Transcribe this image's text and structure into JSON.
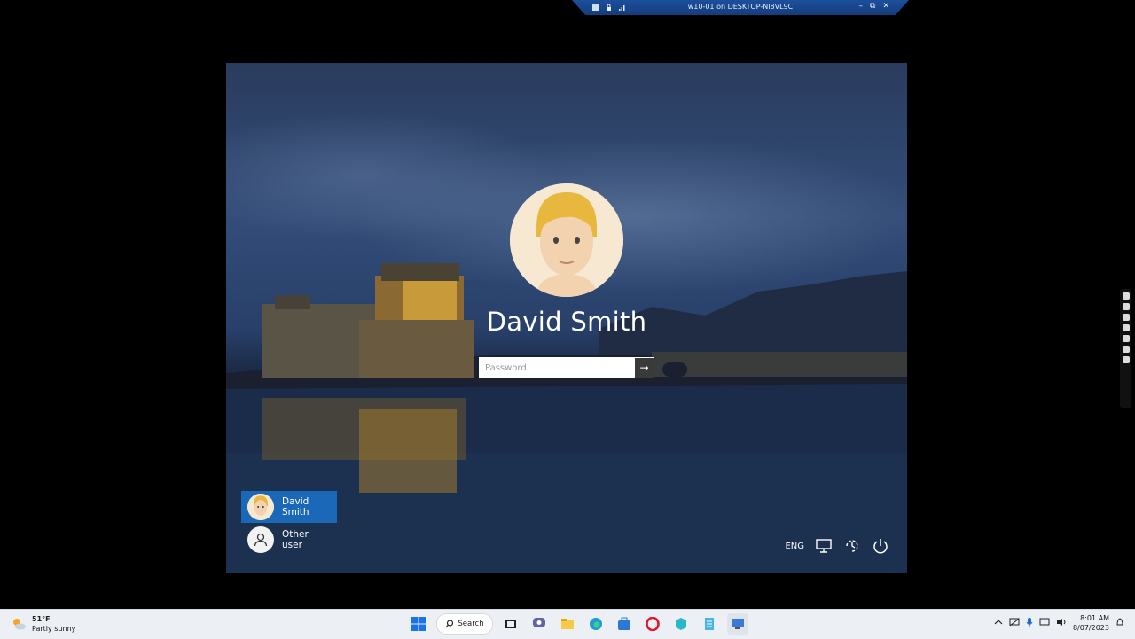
{
  "connection_bar": {
    "title": "w10-01 on DESKTOP-NI8VL9C",
    "minimize_label": "–",
    "restore_label": "⧉",
    "close_label": "✕"
  },
  "lockscreen": {
    "user_name": "David Smith",
    "password_placeholder": "Password",
    "submit_label": "→",
    "tiles": [
      {
        "label": "David Smith",
        "selected": true
      },
      {
        "label": "Other user",
        "selected": false
      }
    ],
    "language": "ENG",
    "icons": [
      "network-icon",
      "accessibility-icon",
      "power-icon"
    ]
  },
  "taskbar": {
    "weather_temp": "51°F",
    "weather_text": "Partly sunny",
    "search_label": "Search",
    "clock_time": "8:01 AM",
    "clock_date": "8/07/2023",
    "apps": [
      "start-icon",
      "search",
      "task-view-icon",
      "teams-chat-icon",
      "file-explorer-icon",
      "edge-icon",
      "store-icon",
      "opera-icon",
      "app-icon",
      "notepad-icon",
      "remote-desktop-icon"
    ]
  },
  "colors": {
    "selected_tile": "#1b68b8",
    "taskbar_bg": "#eceff4",
    "connection_bar": "#1c4f9c"
  }
}
